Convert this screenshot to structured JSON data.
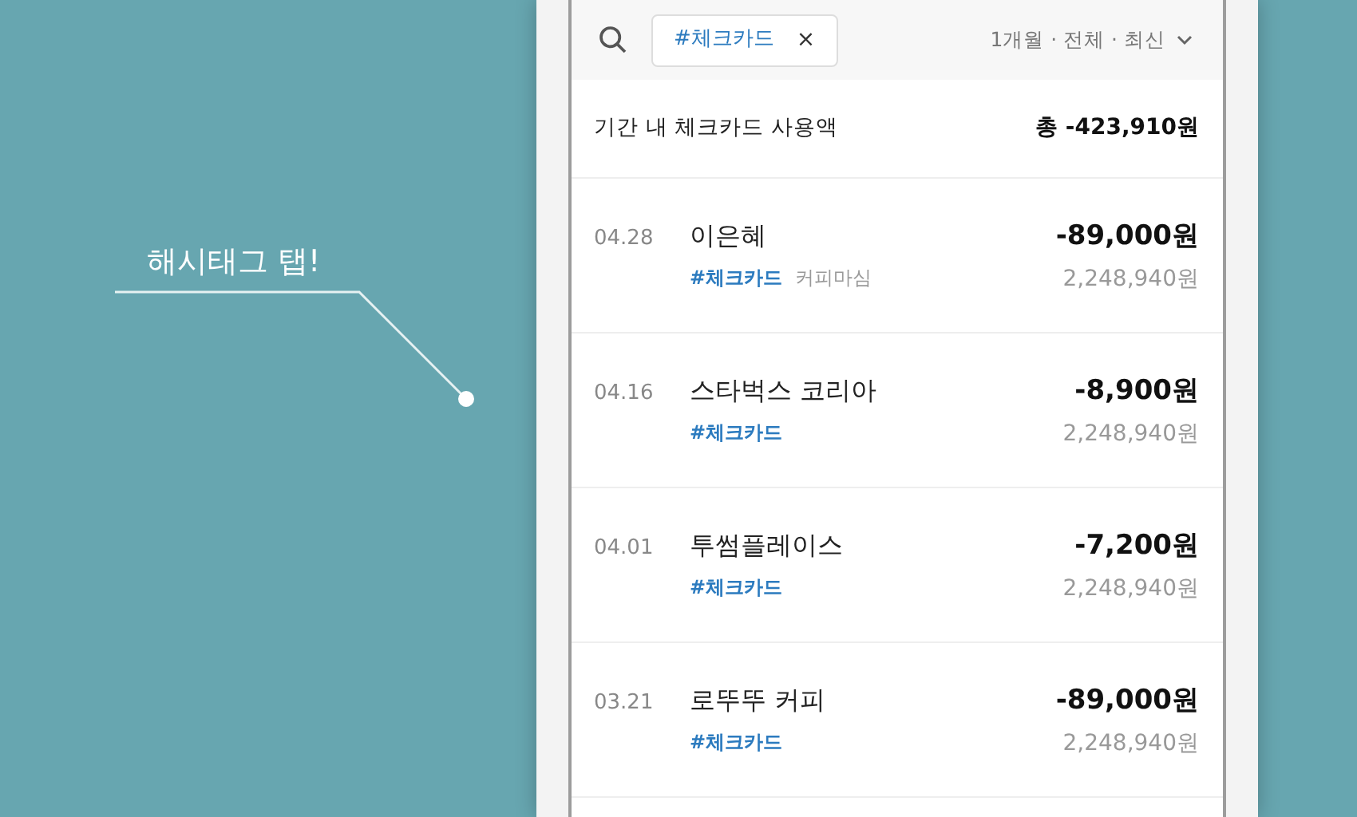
{
  "callout": {
    "text": "해시태그 탭!"
  },
  "filter_bar": {
    "tag": "#체크카드",
    "remove": "×",
    "sort": "1개월 · 전체 · 최신"
  },
  "summary": {
    "label": "기간 내 체크카드 사용액",
    "total": "총 -423,910원"
  },
  "transactions": [
    {
      "date": "04.28",
      "merchant": "이은혜",
      "tag": "#체크카드",
      "memo": "커피마심",
      "amount": "-89,000원",
      "balance": "2,248,940원"
    },
    {
      "date": "04.16",
      "merchant": "스타벅스 코리아",
      "tag": "#체크카드",
      "amount": "-8,900원",
      "balance": "2,248,940원"
    },
    {
      "date": "04.01",
      "merchant": "투썸플레이스",
      "tag": "#체크카드",
      "amount": "-7,200원",
      "balance": "2,248,940원"
    },
    {
      "date": "03.21",
      "merchant": "로뚜뚜 커피",
      "tag": "#체크카드",
      "amount": "-89,000원",
      "balance": "2,248,940원"
    }
  ]
}
